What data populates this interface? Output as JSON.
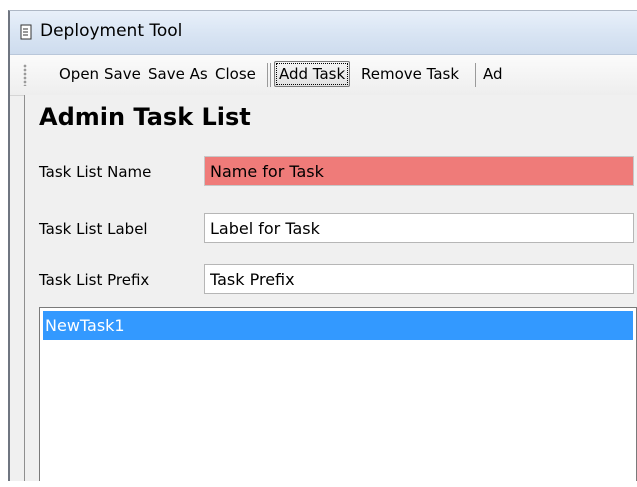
{
  "window": {
    "title": "Deployment Tool"
  },
  "toolbar": {
    "open_label": "Open",
    "save_label": "Save",
    "save_as_label": "Save As",
    "close_label": "Close",
    "add_task_label": "Add Task",
    "remove_task_label": "Remove Task",
    "overflow_label": "Ad"
  },
  "main": {
    "heading": "Admin Task List",
    "fields": [
      {
        "label": "Task List Name",
        "value": "Name for Task"
      },
      {
        "label": "Task List Label",
        "value": "Label for Task"
      },
      {
        "label": "Task List Prefix",
        "value": "Task Prefix"
      }
    ],
    "list": {
      "items": [
        {
          "label": "NewTask1",
          "selected": true
        }
      ]
    }
  },
  "colors": {
    "error_field": "#ef7b79",
    "selection": "#3399ff"
  },
  "icons": {
    "title_icon": "document-icon"
  }
}
